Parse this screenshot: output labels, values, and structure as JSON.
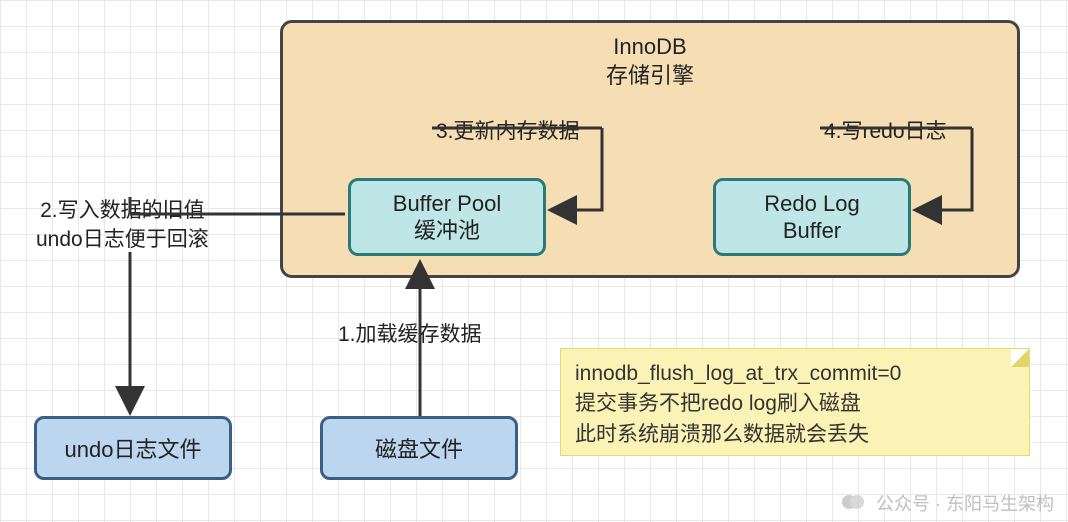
{
  "innodb": {
    "title_line1": "InnoDB",
    "title_line2": "存储引擎"
  },
  "boxes": {
    "buffer_pool_line1": "Buffer Pool",
    "buffer_pool_line2": "缓冲池",
    "redo_log_buffer_line1": "Redo Log",
    "redo_log_buffer_line2": "Buffer",
    "undo_file": "undo日志文件",
    "disk_file": "磁盘文件"
  },
  "steps": {
    "s1": "1.加载缓存数据",
    "s2_line1": "2.写入数据的旧值",
    "s2_line2": "undo日志便于回滚",
    "s3": "3.更新内存数据",
    "s4": "4.写redo日志"
  },
  "note": {
    "line1": "innodb_flush_log_at_trx_commit=0",
    "line2": "提交事务不把redo log刷入磁盘",
    "line3": "此时系统崩溃那么数据就会丢失"
  },
  "watermark": {
    "label": "公众号 · 东阳马生架构"
  },
  "colors": {
    "grid": "#e8e8e8",
    "innodb_bg": "#f5deb3",
    "innodb_border": "#444444",
    "buffer_bg": "#bfe6e6",
    "buffer_border": "#2b7a7a",
    "disk_bg": "#bdd6ef",
    "disk_border": "#3a5f85",
    "note_bg": "#fbf3b5",
    "arrow": "#333333"
  }
}
